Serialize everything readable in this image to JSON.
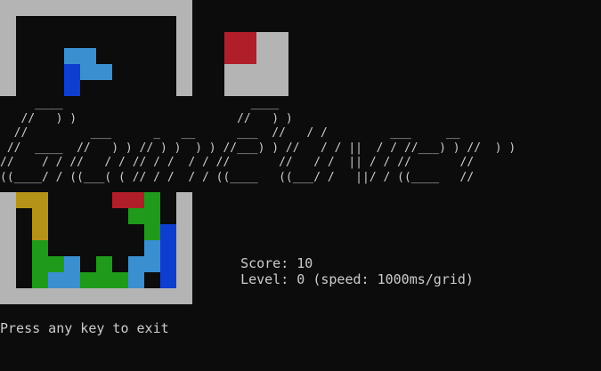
{
  "title_art": [
    "     ____                           ____",
    "   //   ) )                       //   ) )",
    "  //         ___      _   __      ___  //   / /         ___     __",
    " //  ____  //   ) ) // ) )  ) ) //___) ) //   / / ||  / / //___) ) //  ) )",
    "//    / / //   / / // / /  / / //       //   / /  || / / //       //",
    "((____/ / ((___( ( // / /  / / ((____   ((___/ /   ||/ / ((____   //"
  ],
  "stats": {
    "score_label": "Score:",
    "score_value": "10",
    "level_label": "Level:",
    "level_value": "0",
    "speed_text": "(speed: 1000ms/grid)"
  },
  "exit_prompt": "Press any key to exit",
  "colors": {
    "background": "#0c0c0c",
    "frame": "#b4b4b4",
    "light_blue": "#3a8fd0",
    "dark_blue": "#0d3ed0",
    "red": "#b01e2a",
    "green": "#1f9a1a",
    "gold": "#b59318"
  }
}
